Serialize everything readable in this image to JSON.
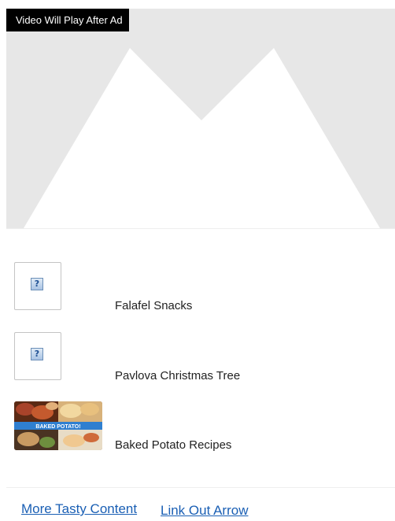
{
  "video": {
    "ad_label": "Video Will Play After Ad"
  },
  "playlist": {
    "items": [
      {
        "title": "Falafel Snacks",
        "thumbnail": "broken-image-icon"
      },
      {
        "title": "Pavlova Christmas Tree",
        "thumbnail": "broken-image-icon"
      },
      {
        "title": "Baked Potato Recipes",
        "thumbnail": "baked-potato-thumbnail",
        "thumb_text": "BAKED POTATO!"
      }
    ]
  },
  "footer": {
    "more_link": "More Tasty Content",
    "arrow_alt": "Link Out Arrow"
  },
  "colors": {
    "player_bg": "#e7e7e7",
    "link": "#1a5fb4",
    "ad_label_bg": "#000000"
  }
}
